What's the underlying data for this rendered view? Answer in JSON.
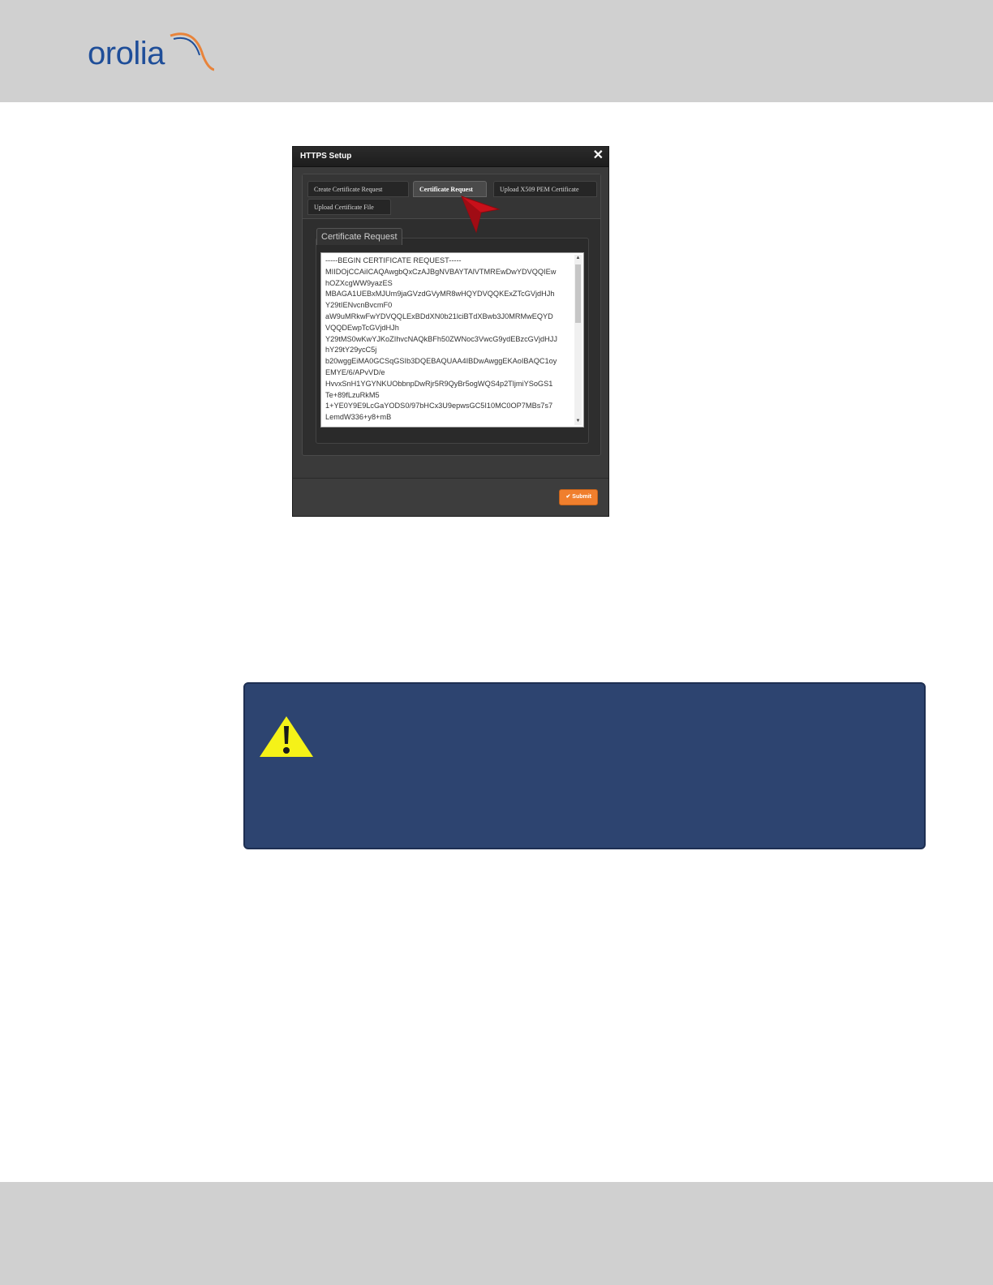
{
  "header": {
    "logo_text": "orolia"
  },
  "dialog": {
    "title": "HTTPS Setup",
    "close_glyph": "✕",
    "tabs": [
      {
        "label": "Create Certificate Request",
        "active": false
      },
      {
        "label": "Certificate Request",
        "active": true
      },
      {
        "label": "Upload X509 PEM Certificate",
        "active": false
      },
      {
        "label": "Upload Certificate File",
        "active": false
      }
    ],
    "panel_title": "Certificate Request",
    "certificate_lines": [
      "-----BEGIN CERTIFICATE REQUEST-----",
      "MIIDOjCCAiICAQAwgbQxCzAJBgNVBAYTAlVTMREwDwYDVQQIEw",
      "hOZXcgWW9yazES",
      "MBAGA1UEBxMJUm9jaGVzdGVyMR8wHQYDVQQKExZTcGVjdHJh",
      "Y29tIENvcnBvcmF0",
      "aW9uMRkwFwYDVQQLExBDdXN0b21lciBTdXBwb3J0MRMwEQYD",
      "VQQDEwpTcGVjdHJh",
      "Y29tMS0wKwYJKoZIhvcNAQkBFh50ZWNoc3VwcG9ydEBzcGVjdHJJ",
      "hY29tY29ycC5j",
      "b20wggEiMA0GCSqGSIb3DQEBAQUAA4IBDwAwggEKAoIBAQC1oy",
      "EMYE/6/APvVD/e",
      "HvvxSnH1YGYNKUObbnpDwRjr5R9QyBr5ogWQS4p2TljmiYSoGS1",
      "Te+89fLzuRkM5",
      "1+YE0Y9E9LcGaYODS0/97bHCx3U9epwsGC5I10MC0OP7MBs7s7",
      "LemdW336+y8+mB"
    ],
    "scroll_up_glyph": "▲",
    "scroll_down_glyph": "▼",
    "submit_label": "✔ Submit"
  },
  "caution": {
    "icon": "warning-icon"
  },
  "colors": {
    "header_band": "#d0d0d0",
    "caution_bg": "#2d4470",
    "warning_yellow": "#f5f218",
    "submit_orange": "#f07f2d",
    "pointer_red": "#c8101a"
  }
}
